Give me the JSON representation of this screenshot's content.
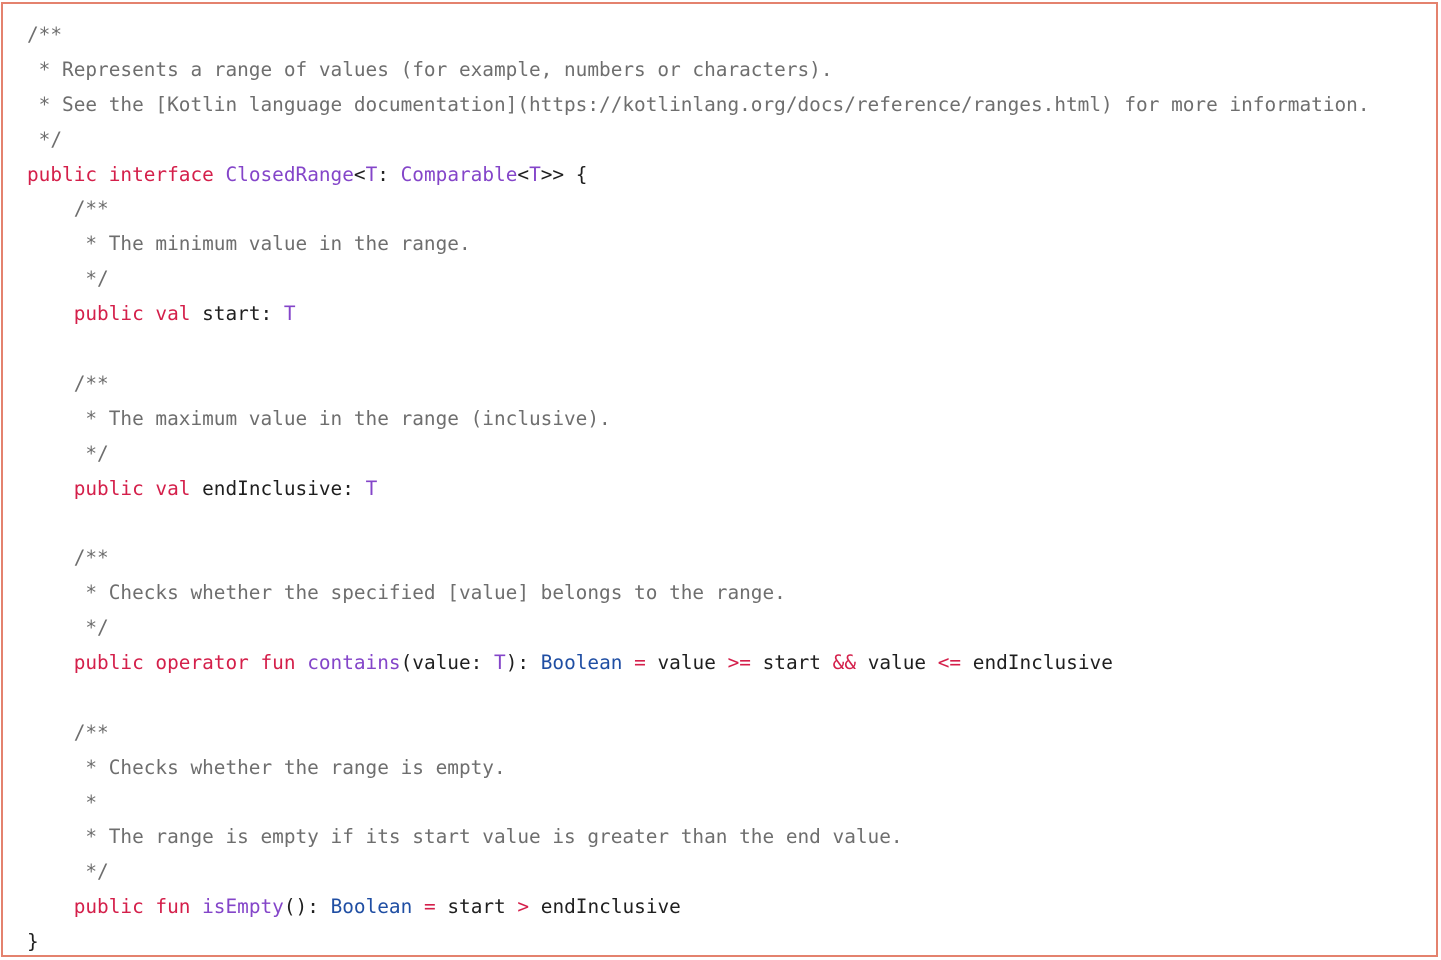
{
  "code": {
    "lines": [
      [
        {
          "cls": "cm",
          "text": "/**"
        }
      ],
      [
        {
          "cls": "cm",
          "text": " * Represents a range of values (for example, numbers or characters)."
        }
      ],
      [
        {
          "cls": "cm",
          "text": " * See the [Kotlin language documentation](https://kotlinlang.org/docs/reference/ranges.html) for more information."
        }
      ],
      [
        {
          "cls": "cm",
          "text": " */"
        }
      ],
      [
        {
          "cls": "kw",
          "text": "public interface "
        },
        {
          "cls": "ty",
          "text": "ClosedRange"
        },
        {
          "cls": "tx",
          "text": "<"
        },
        {
          "cls": "ty",
          "text": "T"
        },
        {
          "cls": "tx",
          "text": ": "
        },
        {
          "cls": "ty",
          "text": "Comparable"
        },
        {
          "cls": "tx",
          "text": "<"
        },
        {
          "cls": "ty",
          "text": "T"
        },
        {
          "cls": "tx",
          "text": ">> {"
        }
      ],
      [
        {
          "cls": "cm",
          "text": "    /**"
        }
      ],
      [
        {
          "cls": "cm",
          "text": "     * The minimum value in the range."
        }
      ],
      [
        {
          "cls": "cm",
          "text": "     */"
        }
      ],
      [
        {
          "cls": "tx",
          "text": "    "
        },
        {
          "cls": "kw",
          "text": "public val "
        },
        {
          "cls": "tx",
          "text": "start: "
        },
        {
          "cls": "ty",
          "text": "T"
        }
      ],
      [],
      [
        {
          "cls": "cm",
          "text": "    /**"
        }
      ],
      [
        {
          "cls": "cm",
          "text": "     * The maximum value in the range (inclusive)."
        }
      ],
      [
        {
          "cls": "cm",
          "text": "     */"
        }
      ],
      [
        {
          "cls": "tx",
          "text": "    "
        },
        {
          "cls": "kw",
          "text": "public val "
        },
        {
          "cls": "tx",
          "text": "endInclusive: "
        },
        {
          "cls": "ty",
          "text": "T"
        }
      ],
      [],
      [
        {
          "cls": "cm",
          "text": "    /**"
        }
      ],
      [
        {
          "cls": "cm",
          "text": "     * Checks whether the specified [value] belongs to the range."
        }
      ],
      [
        {
          "cls": "cm",
          "text": "     */"
        }
      ],
      [
        {
          "cls": "tx",
          "text": "    "
        },
        {
          "cls": "kw",
          "text": "public operator fun "
        },
        {
          "cls": "fn",
          "text": "contains"
        },
        {
          "cls": "tx",
          "text": "(value: "
        },
        {
          "cls": "ty",
          "text": "T"
        },
        {
          "cls": "tx",
          "text": "): "
        },
        {
          "cls": "bt",
          "text": "Boolean"
        },
        {
          "cls": "tx",
          "text": " "
        },
        {
          "cls": "op",
          "text": "="
        },
        {
          "cls": "tx",
          "text": " value "
        },
        {
          "cls": "op",
          "text": ">="
        },
        {
          "cls": "tx",
          "text": " start "
        },
        {
          "cls": "op",
          "text": "&&"
        },
        {
          "cls": "tx",
          "text": " value "
        },
        {
          "cls": "op",
          "text": "<="
        },
        {
          "cls": "tx",
          "text": " endInclusive"
        }
      ],
      [],
      [
        {
          "cls": "cm",
          "text": "    /**"
        }
      ],
      [
        {
          "cls": "cm",
          "text": "     * Checks whether the range is empty."
        }
      ],
      [
        {
          "cls": "cm",
          "text": "     *"
        }
      ],
      [
        {
          "cls": "cm",
          "text": "     * The range is empty if its start value is greater than the end value."
        }
      ],
      [
        {
          "cls": "cm",
          "text": "     */"
        }
      ],
      [
        {
          "cls": "tx",
          "text": "    "
        },
        {
          "cls": "kw",
          "text": "public fun "
        },
        {
          "cls": "fn",
          "text": "isEmpty"
        },
        {
          "cls": "tx",
          "text": "(): "
        },
        {
          "cls": "bt",
          "text": "Boolean"
        },
        {
          "cls": "tx",
          "text": " "
        },
        {
          "cls": "op",
          "text": "="
        },
        {
          "cls": "tx",
          "text": " start "
        },
        {
          "cls": "op",
          "text": ">"
        },
        {
          "cls": "tx",
          "text": " endInclusive"
        }
      ],
      [
        {
          "cls": "tx",
          "text": "}"
        }
      ]
    ]
  },
  "colors": {
    "border": "#e4826e",
    "comment": "#6e6e6e",
    "keyword": "#d41f4a",
    "type": "#8445c9",
    "builtin_type": "#1f4ea3",
    "text": "#1f1f1f"
  }
}
